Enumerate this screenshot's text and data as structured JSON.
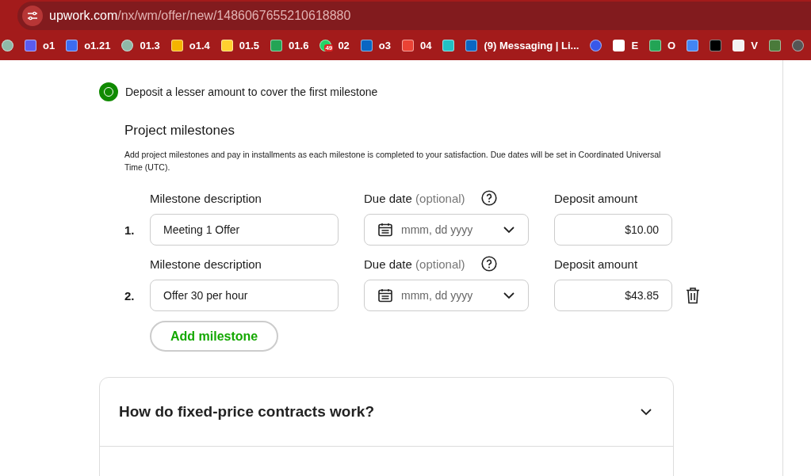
{
  "browser": {
    "url_host": "upwork.com",
    "url_path": "/nx/wm/offer/new/1486067655210618880",
    "bookmarks": [
      {
        "kind": "chat"
      },
      {
        "kind": "shield",
        "label": "o1"
      },
      {
        "kind": "dots",
        "label": "o1.21"
      },
      {
        "kind": "chat",
        "label": "01.3"
      },
      {
        "kind": "drive",
        "label": "o1.4"
      },
      {
        "kind": "miro",
        "label": "01.5"
      },
      {
        "kind": "plus",
        "label": "01.6"
      },
      {
        "kind": "whatsapp",
        "label": "02",
        "badge": "49"
      },
      {
        "kind": "linkedin",
        "label": "o3"
      },
      {
        "kind": "gmail",
        "label": "04"
      },
      {
        "kind": "teal"
      },
      {
        "kind": "linkedin",
        "label": "(9) Messaging | Li..."
      },
      {
        "kind": "wordpress"
      },
      {
        "kind": "wix",
        "label": "E"
      },
      {
        "kind": "plus",
        "label": "O"
      },
      {
        "kind": "calendar"
      },
      {
        "kind": "x"
      },
      {
        "kind": "pencil",
        "label": "V"
      },
      {
        "kind": "figure"
      },
      {
        "kind": "rock"
      }
    ]
  },
  "option": {
    "label": "Deposit a lesser amount to cover the first milestone",
    "selected": true
  },
  "milestones": {
    "title": "Project milestones",
    "description": "Add project milestones and pay in installments as each milestone is completed to your satisfaction. Due dates will be set in Coordinated Universal Time (UTC).",
    "rows": [
      {
        "number": "1.",
        "description_label": "Milestone description",
        "description": "Meeting 1 Offer",
        "date_label": "Due date",
        "date_hint": "(optional)",
        "date_placeholder": "mmm, dd yyyy",
        "amount_label": "Deposit amount",
        "amount": "$10.00",
        "deletable": false
      },
      {
        "number": "2.",
        "description_label": "Milestone description",
        "description": "Offer 30 per hour",
        "date_label": "Due date",
        "date_hint": "(optional)",
        "date_placeholder": "mmm, dd yyyy",
        "amount_label": "Deposit amount",
        "amount": "$43.85",
        "deletable": true
      }
    ],
    "add_button": "Add milestone"
  },
  "faq": [
    {
      "question": "How do fixed-price contracts work?",
      "expanded": false
    }
  ]
}
